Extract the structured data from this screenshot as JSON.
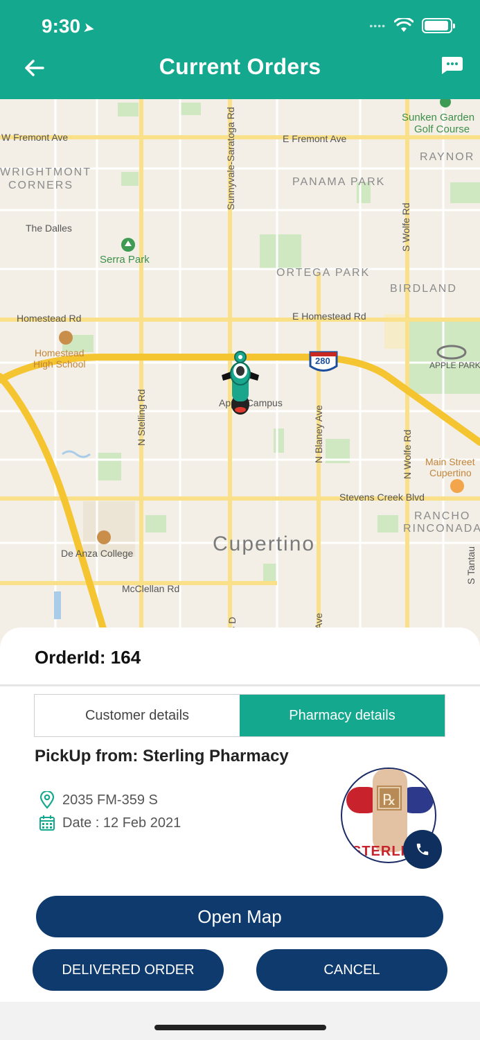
{
  "status_bar": {
    "time": "9:30"
  },
  "header": {
    "title": "Current Orders"
  },
  "map": {
    "labels": {
      "w_fremont": "W Fremont Ave",
      "e_fremont": "E Fremont Ave",
      "sunken_1": "Sunken Garden",
      "sunken_2": "Golf Course",
      "raynor": "RAYNOR",
      "wrightmont_1": "WRIGHTMONT",
      "wrightmont_2": "CORNERS",
      "panama": "PANAMA PARK",
      "sunnyvale": "Sunnyvale-Saratoga Rd",
      "s_wolfe": "S Wolfe Rd",
      "dalles": "The Dalles",
      "serra": "Serra Park",
      "ortega": "ORTEGA PARK",
      "birdland": "BIRDLAND",
      "homestead_w": "Homestead Rd",
      "homestead_e": "E Homestead Rd",
      "hs_1": "Homestead",
      "hs_2": "High School",
      "i280": "280",
      "apple_park": "APPLE PARK",
      "apple_campus": "Apple Campus",
      "n_stelling": "N Stelling Rd",
      "n_blaney": "N Blaney Ave",
      "n_wolfe": "N Wolfe Rd",
      "main_1": "Main Street",
      "main_2": "Cupertino",
      "stevens": "Stevens Creek Blvd",
      "rancho_1": "RANCHO",
      "rancho_2": "RINCONADA",
      "de_anza": "De Anza College",
      "cupertino": "Cupertino",
      "mcclellan": "McClellan Rd",
      "s_tantau": "S Tantau",
      "s_d": "S D",
      "ave": "Ave"
    }
  },
  "order": {
    "order_id_label": "OrderId: 164",
    "tabs": [
      {
        "label": "Customer details",
        "active": false
      },
      {
        "label": "Pharmacy details",
        "active": true
      }
    ],
    "pickup": "PickUp from: Sterling Pharmacy",
    "address": "2035 FM-359 S",
    "date": "Date : 12 Feb 2021",
    "logo_text": "STERLI"
  },
  "actions": {
    "open_map": "Open Map",
    "delivered": "DELIVERED ORDER",
    "cancel": "CANCEL"
  },
  "colors": {
    "header": "#14a88e",
    "button": "#0f3a6e",
    "tab_active": "#14a88e"
  }
}
